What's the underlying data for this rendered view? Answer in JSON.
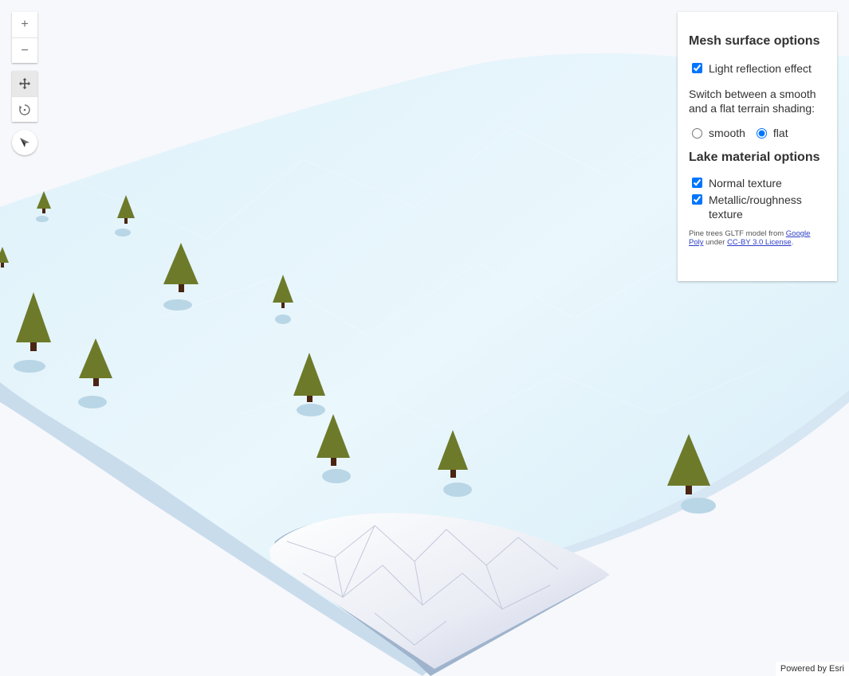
{
  "zoom": {
    "in_symbol": "+",
    "out_symbol": "−"
  },
  "nav": {
    "pan_icon": "pan-arrows-icon",
    "rotate_icon": "rotate-icon",
    "compass_icon": "compass-icon"
  },
  "panel": {
    "heading_mesh": "Mesh surface options",
    "light_reflection_label": "Light reflection effect",
    "light_reflection_checked": true,
    "shading_text": "Switch between a smooth and a flat terrain shading:",
    "shading_options": [
      "smooth",
      "flat"
    ],
    "shading_selected": "flat",
    "heading_lake": "Lake material options",
    "normal_texture_label": "Normal texture",
    "normal_texture_checked": true,
    "metallic_label": "Metallic/roughness texture",
    "metallic_checked": true,
    "credits_prefix": "Pine trees GLTF model from ",
    "credits_link1": "Google Poly",
    "credits_mid": " under ",
    "credits_link2": "CC-BY 3.0 License",
    "credits_suffix": "."
  },
  "attribution": "Powered by Esri",
  "colors": {
    "snow": "#e6f4fb",
    "ice_edge": "#c5dcf0",
    "tree_green": "#6d7a2a",
    "trunk": "#4a2612"
  }
}
